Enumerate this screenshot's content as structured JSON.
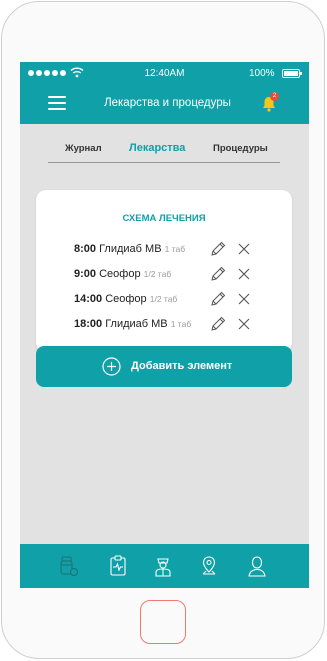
{
  "status_bar": {
    "time": "12:40AM",
    "battery": "100%",
    "battery_level": 1.0
  },
  "navbar": {
    "title": "Лекарства и процедуры",
    "notification_count": "2"
  },
  "tabs": [
    {
      "label": "Журнал",
      "active": false
    },
    {
      "label": "Лекарства",
      "active": true
    },
    {
      "label": "Процедуры",
      "active": false
    }
  ],
  "schedule": {
    "title": "СХЕМА ЛЕЧЕНИЯ",
    "items": [
      {
        "time": "8:00",
        "name": "Глидиаб МВ",
        "dose": "1 таб"
      },
      {
        "time": "9:00",
        "name": "Сеофор",
        "dose": "1/2 таб"
      },
      {
        "time": "14:00",
        "name": "Сеофор",
        "dose": "1/2 таб"
      },
      {
        "time": "18:00",
        "name": "Глидиаб МВ",
        "dose": "1 таб"
      }
    ],
    "add_label": "Добавить элемент"
  },
  "colors": {
    "accent": "#0fa0a8",
    "badge": "#e74c3c",
    "background": "#e2e2e2"
  },
  "tabbar_icons": [
    "pills-icon",
    "clipboard-ecg-icon",
    "doctor-icon",
    "map-pin-icon",
    "user-icon"
  ]
}
